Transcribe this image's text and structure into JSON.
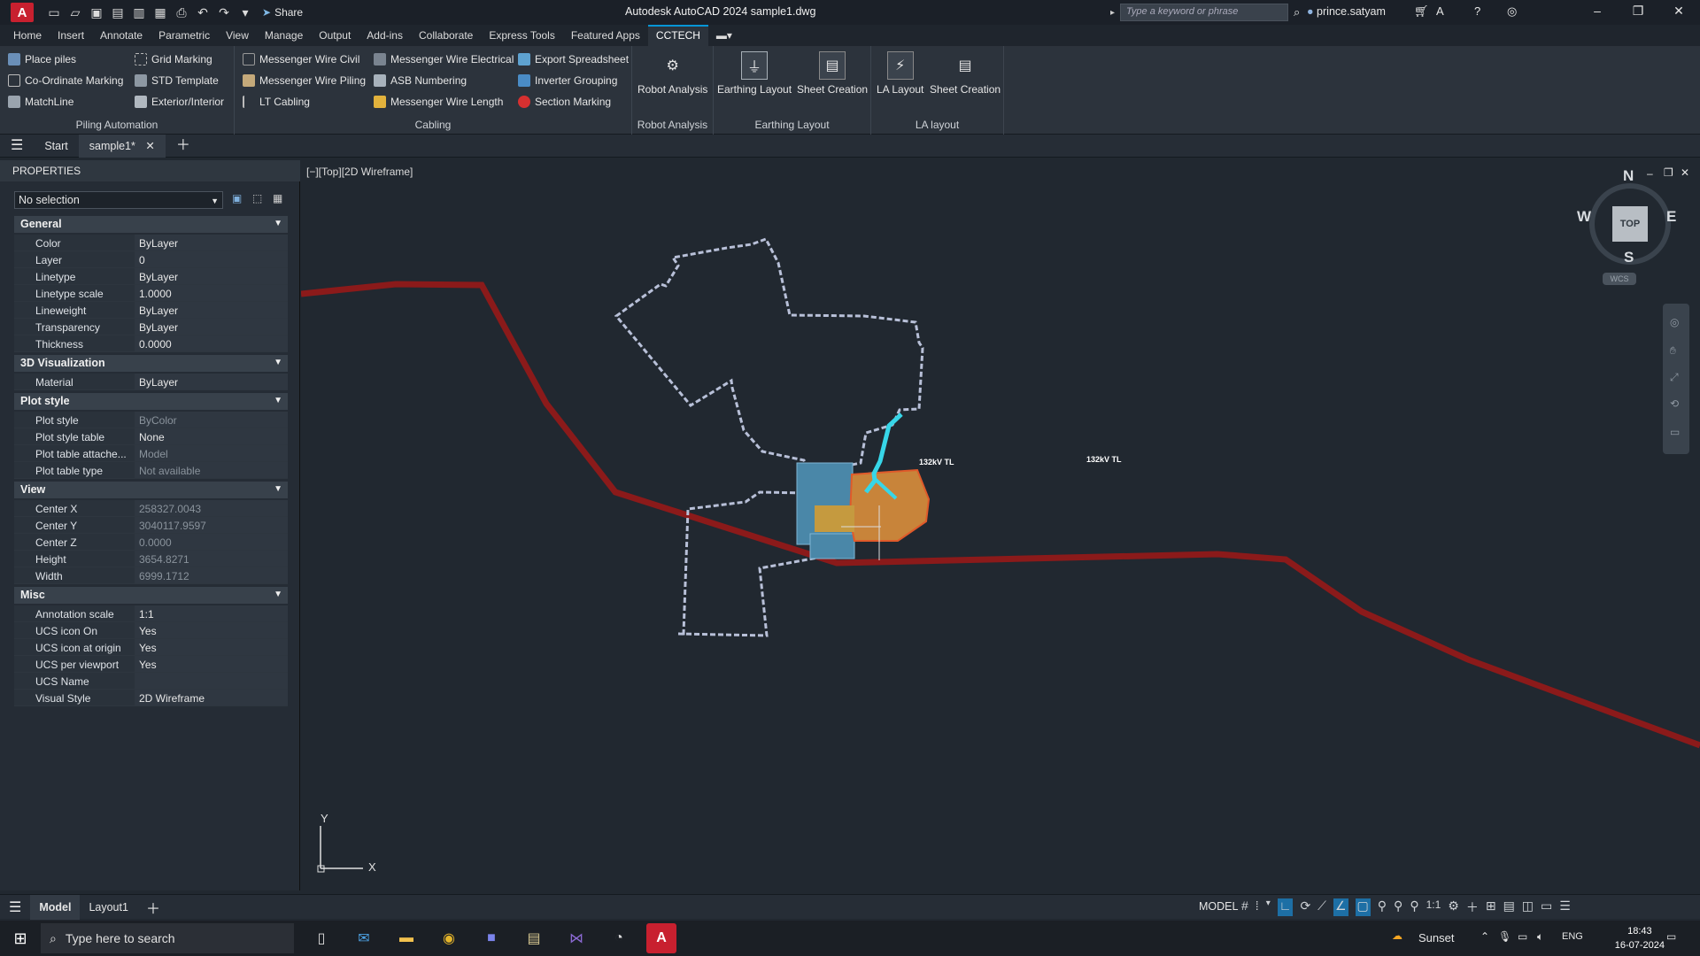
{
  "titlebar": {
    "app_title": "Autodesk AutoCAD 2024   sample1.dwg",
    "share_label": "Share",
    "search_placeholder": "Type a keyword or phrase",
    "user_name": "prince.satyam"
  },
  "ribbon_tabs": [
    "Home",
    "Insert",
    "Annotate",
    "Parametric",
    "View",
    "Manage",
    "Output",
    "Add-ins",
    "Collaborate",
    "Express Tools",
    "Featured Apps",
    "CCTECH"
  ],
  "ribbon": {
    "piling": {
      "label": "Piling Automation",
      "items": [
        "Place piles",
        "Co-Ordinate Marking",
        "MatchLine",
        "Grid Marking",
        "STD Template",
        "Exterior/Interior"
      ]
    },
    "cabling": {
      "label": "Cabling",
      "items": [
        "Messenger Wire Civil",
        "Messenger Wire Piling",
        "LT Cabling",
        "Messenger Wire Electrical",
        "ASB Numbering",
        "Messenger Wire Length",
        "Export Spreadsheet",
        "Inverter Grouping",
        "Section Marking"
      ]
    },
    "robot": {
      "label": "Robot Analysis",
      "button": "Robot Analysis"
    },
    "earthing": {
      "label": "Earthing Layout",
      "buttons": [
        "Earthing Layout",
        "Sheet Creation"
      ]
    },
    "la": {
      "label": "LA layout",
      "buttons": [
        "LA Layout",
        "Sheet Creation"
      ]
    }
  },
  "file_tabs": {
    "start": "Start",
    "active": "sample1*"
  },
  "properties": {
    "title": "PROPERTIES",
    "selection": "No selection",
    "sections": {
      "general": "General",
      "viz": "3D Visualization",
      "plot": "Plot style",
      "view": "View",
      "misc": "Misc"
    },
    "general": [
      {
        "n": "Color",
        "v": "ByLayer"
      },
      {
        "n": "Layer",
        "v": "0"
      },
      {
        "n": "Linetype",
        "v": "ByLayer"
      },
      {
        "n": "Linetype scale",
        "v": "1.0000"
      },
      {
        "n": "Lineweight",
        "v": "ByLayer"
      },
      {
        "n": "Transparency",
        "v": "ByLayer"
      },
      {
        "n": "Thickness",
        "v": "0.0000"
      }
    ],
    "viz": [
      {
        "n": "Material",
        "v": "ByLayer"
      }
    ],
    "plot": [
      {
        "n": "Plot style",
        "v": "ByColor"
      },
      {
        "n": "Plot style table",
        "v": "None"
      },
      {
        "n": "Plot table attache...",
        "v": "Model"
      },
      {
        "n": "Plot table type",
        "v": "Not available"
      }
    ],
    "view": [
      {
        "n": "Center X",
        "v": "258327.0043"
      },
      {
        "n": "Center Y",
        "v": "3040117.9597"
      },
      {
        "n": "Center Z",
        "v": "0.0000"
      },
      {
        "n": "Height",
        "v": "3654.8271"
      },
      {
        "n": "Width",
        "v": "6999.1712"
      }
    ],
    "misc": [
      {
        "n": "Annotation scale",
        "v": "1:1"
      },
      {
        "n": "UCS icon On",
        "v": "Yes"
      },
      {
        "n": "UCS icon at origin",
        "v": "Yes"
      },
      {
        "n": "UCS per viewport",
        "v": "Yes"
      },
      {
        "n": "UCS Name",
        "v": ""
      },
      {
        "n": "Visual Style",
        "v": "2D Wireframe"
      }
    ]
  },
  "viewport": {
    "label": "[−][Top][2D Wireframe]",
    "viewcube": {
      "top": "TOP",
      "n": "N",
      "s": "S",
      "e": "E",
      "w": "W",
      "wcs": "WCS"
    },
    "line_label_1": "132kV TL",
    "line_label_2": "132kV TL",
    "ucs_x": "X",
    "ucs_y": "Y"
  },
  "layout_tabs": {
    "model": "Model",
    "layout1": "Layout1"
  },
  "status": {
    "model": "MODEL",
    "scale": "1:1"
  },
  "taskbar": {
    "search": "Type here to search",
    "weather": "Sunset",
    "lang": "ENG",
    "time": "18:43",
    "date": "16-07-2024"
  },
  "colors": {
    "accent": "#0696d7",
    "transmission_line": "#8b1a1a",
    "boundary": "#b8c0d8",
    "cable": "#37d6e8"
  }
}
